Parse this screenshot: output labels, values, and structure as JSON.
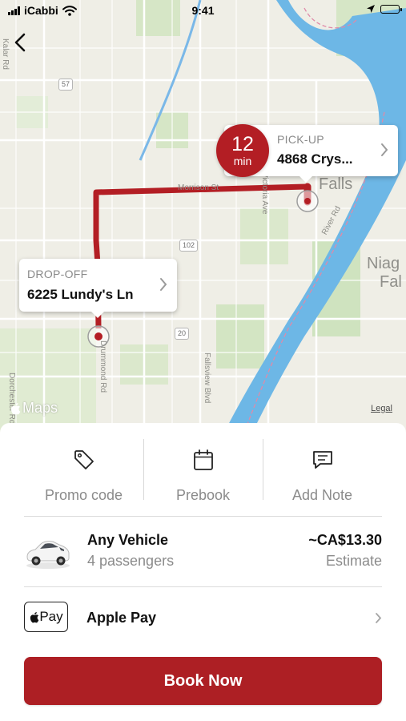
{
  "status_bar": {
    "carrier": "iCabbi",
    "time": "9:41",
    "icons": [
      "signal-bars-icon",
      "wifi-icon",
      "location-arrow-icon",
      "battery-icon"
    ]
  },
  "navigation": {
    "back_icon": "chevron-left-icon"
  },
  "map": {
    "attribution": "Maps",
    "legal_label": "Legal",
    "street_labels": [
      "Morrison St",
      "Victoria Ave",
      "River Rd",
      "Drummond Rd",
      "Fallsview Blvd",
      "Dorchester Rd",
      "Kalar Rd"
    ],
    "place_labels": [
      "Falls",
      "Niag",
      "Fal"
    ],
    "route_shields": [
      "57",
      "102",
      "20"
    ],
    "route_color": "#b31e24",
    "water_color": "#6db7e6"
  },
  "pickup": {
    "title": "PICK-UP",
    "address": "4868 Crys...",
    "eta_value": "12",
    "eta_unit": "min"
  },
  "dropoff": {
    "title": "DROP-OFF",
    "address": "6225 Lundy's Ln"
  },
  "options": [
    {
      "label": "Promo code",
      "icon": "tag-icon"
    },
    {
      "label": "Prebook",
      "icon": "calendar-icon"
    },
    {
      "label": "Add Note",
      "icon": "message-icon"
    }
  ],
  "vehicle": {
    "name": "Any Vehicle",
    "passengers": "4 passengers",
    "price": "~CA$13.30",
    "price_note": "Estimate",
    "icon": "car-icon"
  },
  "payment": {
    "badge": "Pay",
    "method": "Apple Pay",
    "icon": "apple-pay-icon"
  },
  "book_button": {
    "label": "Book Now"
  },
  "colors": {
    "accent": "#ad1f24",
    "muted_text": "#8b8b8b"
  }
}
